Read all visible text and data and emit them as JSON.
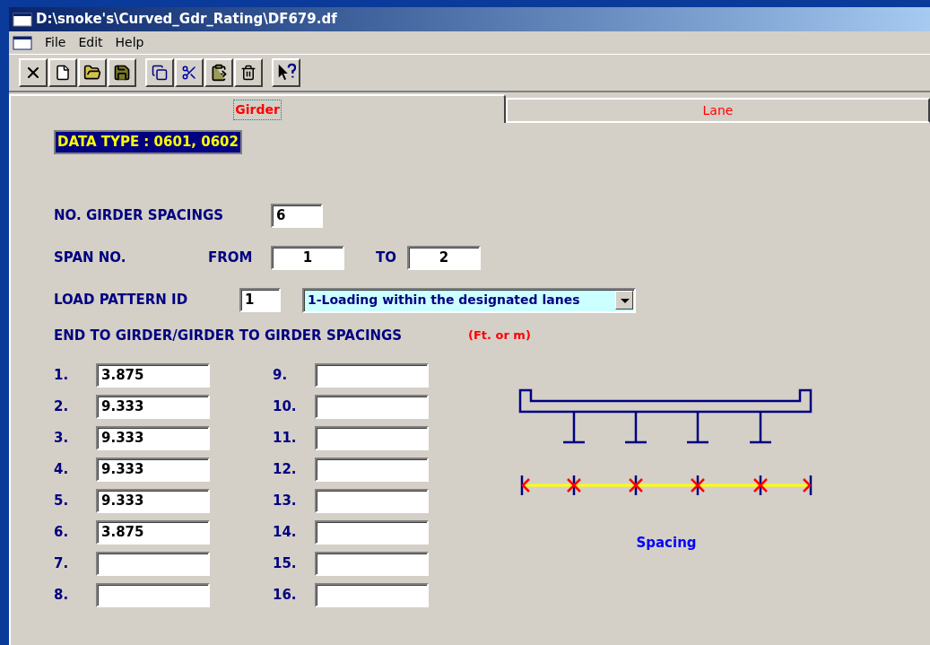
{
  "window": {
    "title": "D:\\snoke's\\Curved_Gdr_Rating\\DF679.df"
  },
  "menu": [
    "File",
    "Edit",
    "Help"
  ],
  "toolbar": [
    [
      {
        "kind": "close"
      },
      {
        "kind": "new"
      },
      {
        "kind": "open"
      },
      {
        "kind": "save"
      }
    ],
    [
      {
        "kind": "copy"
      },
      {
        "kind": "cut"
      },
      {
        "kind": "paste"
      },
      {
        "kind": "delete"
      }
    ],
    [
      {
        "kind": "help"
      }
    ]
  ],
  "tabs": [
    {
      "label": "Girder",
      "selected": true
    },
    {
      "label": "Lane",
      "selected": false
    }
  ],
  "data_type": "DATA TYPE : 0601, 0602",
  "girder_spacings": {
    "label": "NO. GIRDER SPACINGS",
    "value": "6"
  },
  "span": {
    "label": "SPAN NO.",
    "from_label": "FROM",
    "from": "1",
    "to_label": "TO",
    "to": "2"
  },
  "load_pattern": {
    "label": "LOAD PATTERN ID",
    "id": "1",
    "selection": "1-Loading within the designated lanes"
  },
  "spacings_heading": "END TO GIRDER/GIRDER TO GIRDER SPACINGS",
  "units": "(Ft. or m)",
  "spacings": [
    {
      "number": "1.",
      "value": "3.875"
    },
    {
      "number": "2.",
      "value": "9.333"
    },
    {
      "number": "3.",
      "value": "9.333"
    },
    {
      "number": "4.",
      "value": "9.333"
    },
    {
      "number": "5.",
      "value": "9.333"
    },
    {
      "number": "6.",
      "value": "3.875"
    },
    {
      "number": "7."
    },
    {
      "number": "8."
    },
    {
      "number": "9."
    },
    {
      "number": "10."
    },
    {
      "number": "11."
    },
    {
      "number": "12."
    },
    {
      "number": "13."
    },
    {
      "number": "14."
    },
    {
      "number": "15."
    },
    {
      "number": "16."
    }
  ],
  "diagram_caption": "Spacing"
}
